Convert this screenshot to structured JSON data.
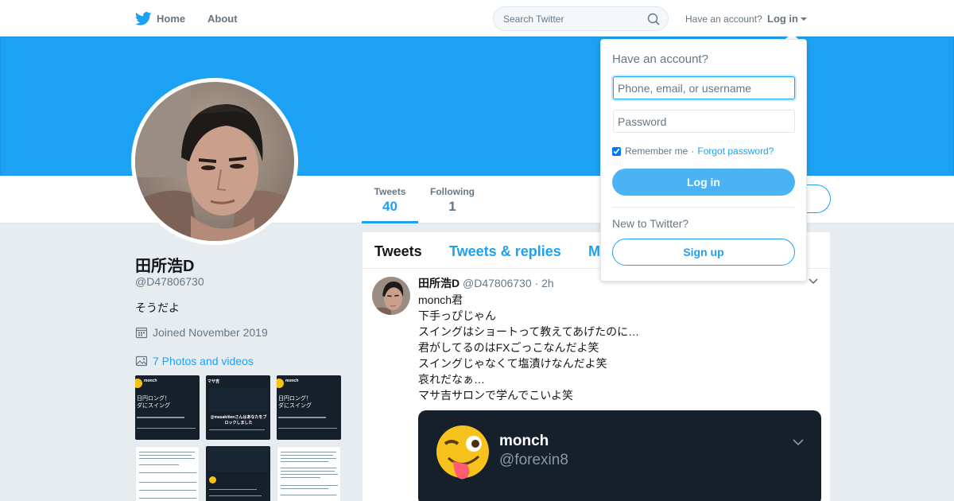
{
  "nav": {
    "home_label": "Home",
    "about_label": "About",
    "search_placeholder": "Search Twitter",
    "have_account": "Have an account?",
    "login_label": "Log in"
  },
  "colors": {
    "brand": "#1da1f2",
    "banner": "#1da1f2",
    "page_bg": "#e6ecf0",
    "dark_card": "#15202b"
  },
  "profile": {
    "name": "田所浩D",
    "handle": "@D47806730",
    "bio": "そうだよ",
    "joined": "Joined November 2019",
    "photos_link": "7 Photos and videos"
  },
  "stats": [
    {
      "label": "Tweets",
      "value": "40",
      "active": true
    },
    {
      "label": "Following",
      "value": "1",
      "active": false
    }
  ],
  "tabs": [
    {
      "label": "Tweets"
    },
    {
      "label": "Tweets & replies"
    },
    {
      "label": "M"
    }
  ],
  "thumbnail_texts": {
    "t1_name": "monch",
    "t1_line": "日円ロング！",
    "t1_line2": "ダにスイング",
    "t2_name": "マサ吉",
    "t2_line": "@masakitienさんはあなたをブロックしました",
    "t3_name": "monch",
    "t3_line": "日円ロング！",
    "t3_line2": "ダにスイング"
  },
  "tweet": {
    "name": "田所浩D",
    "handle": "@D47806730",
    "dot": "·",
    "time": "2h",
    "lines": [
      "monch君",
      "下手っぴじゃん",
      "スイングはショートって教えてあげたのに…",
      "君がしてるのはFXごっこなんだよ笑",
      "スイングじゃなくて塩漬けなんだよ笑",
      "哀れだなぁ…",
      "マサ吉サロンで学んでこいよ笑"
    ],
    "media": {
      "name": "monch",
      "handle": "@forexin8"
    }
  },
  "login_dropdown": {
    "title": "Have an account?",
    "username_placeholder": "Phone, email, or username",
    "password_placeholder": "Password",
    "remember_label": "Remember me",
    "separator": "·",
    "forgot_label": "Forgot password?",
    "login_button": "Log in",
    "new_label": "New to Twitter?",
    "signup_button": "Sign up"
  }
}
